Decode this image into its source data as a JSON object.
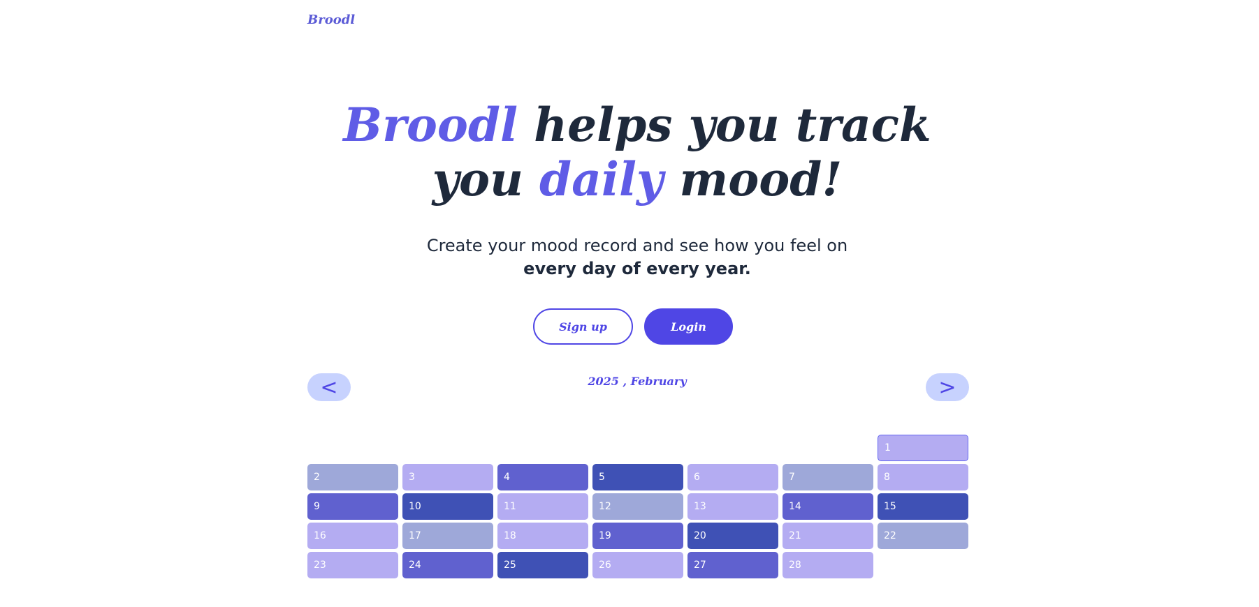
{
  "brand": {
    "name": "Broodl"
  },
  "hero": {
    "line1_accent": "Broodl",
    "line1_rest": " helps you track",
    "line2_start": "you ",
    "line2_accent": "daily",
    "line2_end": " mood!"
  },
  "subtitle": {
    "line1": "Create your mood record and see how you feel on",
    "line2_bold": "every day of every year."
  },
  "buttons": {
    "signup": "Sign up",
    "login": "Login"
  },
  "calendar": {
    "prev_label": "<",
    "next_label": ">",
    "month_label": "2025 , February",
    "leading_blanks": 6,
    "colors": {
      "light": "#b4acf2",
      "grey": "#9ea8d9",
      "medium": "#6061cf",
      "dark": "#3f51b5"
    },
    "days": [
      {
        "n": "1",
        "mood": "light"
      },
      {
        "n": "2",
        "mood": "grey"
      },
      {
        "n": "3",
        "mood": "light"
      },
      {
        "n": "4",
        "mood": "medium"
      },
      {
        "n": "5",
        "mood": "dark"
      },
      {
        "n": "6",
        "mood": "light"
      },
      {
        "n": "7",
        "mood": "grey"
      },
      {
        "n": "8",
        "mood": "light"
      },
      {
        "n": "9",
        "mood": "medium"
      },
      {
        "n": "10",
        "mood": "dark"
      },
      {
        "n": "11",
        "mood": "light"
      },
      {
        "n": "12",
        "mood": "grey"
      },
      {
        "n": "13",
        "mood": "light"
      },
      {
        "n": "14",
        "mood": "medium"
      },
      {
        "n": "15",
        "mood": "dark"
      },
      {
        "n": "16",
        "mood": "light"
      },
      {
        "n": "17",
        "mood": "grey"
      },
      {
        "n": "18",
        "mood": "light"
      },
      {
        "n": "19",
        "mood": "medium"
      },
      {
        "n": "20",
        "mood": "dark"
      },
      {
        "n": "21",
        "mood": "light"
      },
      {
        "n": "22",
        "mood": "grey"
      },
      {
        "n": "23",
        "mood": "light"
      },
      {
        "n": "24",
        "mood": "medium"
      },
      {
        "n": "25",
        "mood": "dark"
      },
      {
        "n": "26",
        "mood": "light"
      },
      {
        "n": "27",
        "mood": "medium"
      },
      {
        "n": "28",
        "mood": "light"
      }
    ]
  }
}
